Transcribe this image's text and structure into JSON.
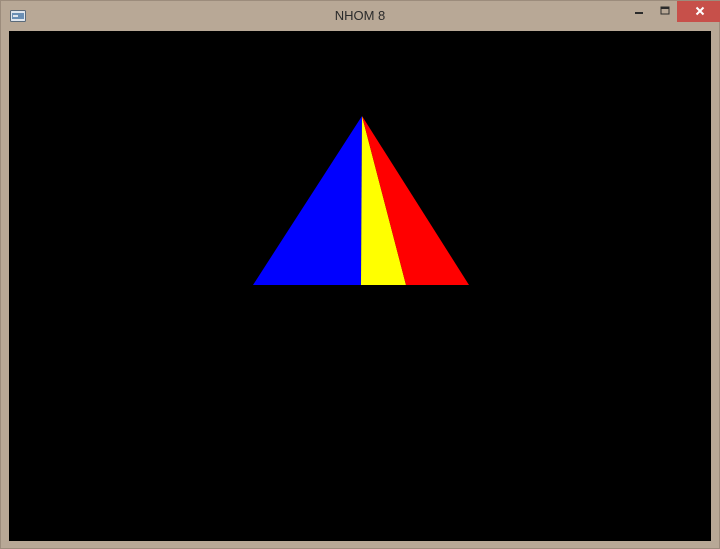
{
  "window": {
    "title": "NHOM 8",
    "icon": "app-icon",
    "controls": {
      "minimize_icon": "minimize-icon",
      "maximize_icon": "maximize-icon",
      "close_icon": "close-icon",
      "close_color": "#c7504a"
    },
    "frame_color": "#b8a896"
  },
  "scene": {
    "background_color": "#000000",
    "pyramid_faces": [
      {
        "name": "left-face",
        "color": "#0000ff"
      },
      {
        "name": "middle-face",
        "color": "#ffff00"
      },
      {
        "name": "right-face",
        "color": "#ff0000"
      }
    ]
  }
}
